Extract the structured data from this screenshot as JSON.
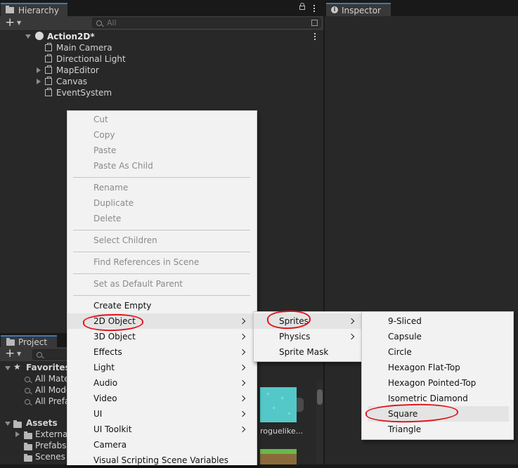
{
  "hierarchy": {
    "tab_label": "Hierarchy",
    "search_placeholder": "All",
    "scene_name": "Action2D*",
    "items": [
      {
        "label": "Main Camera"
      },
      {
        "label": "Directional Light"
      },
      {
        "label": "MapEditor"
      },
      {
        "label": "Canvas"
      },
      {
        "label": "EventSystem"
      }
    ]
  },
  "inspector": {
    "tab_label": "Inspector"
  },
  "project": {
    "tab_label": "Project",
    "favorites_label": "Favorites",
    "favorites": [
      "All Mate",
      "All Mode",
      "All Prefa"
    ],
    "assets_label": "Assets",
    "assets": [
      "External",
      "Prefabs",
      "Scenes"
    ],
    "thumb_label": "roguelike..."
  },
  "context_menu": {
    "items": [
      {
        "label": "Cut",
        "disabled": true
      },
      {
        "label": "Copy",
        "disabled": true
      },
      {
        "label": "Paste",
        "disabled": true
      },
      {
        "label": "Paste As Child",
        "disabled": true
      },
      {
        "label": "Rename",
        "disabled": true
      },
      {
        "label": "Duplicate",
        "disabled": true
      },
      {
        "label": "Delete",
        "disabled": true
      },
      {
        "label": "Select Children",
        "disabled": true
      },
      {
        "label": "Find References in Scene",
        "disabled": true
      },
      {
        "label": "Set as Default Parent",
        "disabled": true
      },
      {
        "label": "Create Empty"
      },
      {
        "label": "2D Object",
        "submenu": true,
        "highlighted": true
      },
      {
        "label": "3D Object",
        "submenu": true
      },
      {
        "label": "Effects",
        "submenu": true
      },
      {
        "label": "Light",
        "submenu": true
      },
      {
        "label": "Audio",
        "submenu": true
      },
      {
        "label": "Video",
        "submenu": true
      },
      {
        "label": "UI",
        "submenu": true
      },
      {
        "label": "UI Toolkit",
        "submenu": true
      },
      {
        "label": "Camera"
      },
      {
        "label": "Visual Scripting Scene Variables"
      }
    ]
  },
  "submenu_2d": {
    "items": [
      {
        "label": "Sprites",
        "submenu": true,
        "highlighted": true
      },
      {
        "label": "Physics",
        "submenu": true
      },
      {
        "label": "Sprite Mask"
      }
    ]
  },
  "submenu_sprites": {
    "items": [
      {
        "label": "9-Sliced"
      },
      {
        "label": "Capsule"
      },
      {
        "label": "Circle"
      },
      {
        "label": "Hexagon Flat-Top"
      },
      {
        "label": "Hexagon Pointed-Top"
      },
      {
        "label": "Isometric Diamond"
      },
      {
        "label": "Square",
        "highlighted": true
      },
      {
        "label": "Triangle"
      }
    ]
  },
  "colors": {
    "accent": "#3a79bb",
    "annotation": "#e0161c",
    "menu_bg": "#f2f2f2",
    "panel_bg": "#282828"
  }
}
